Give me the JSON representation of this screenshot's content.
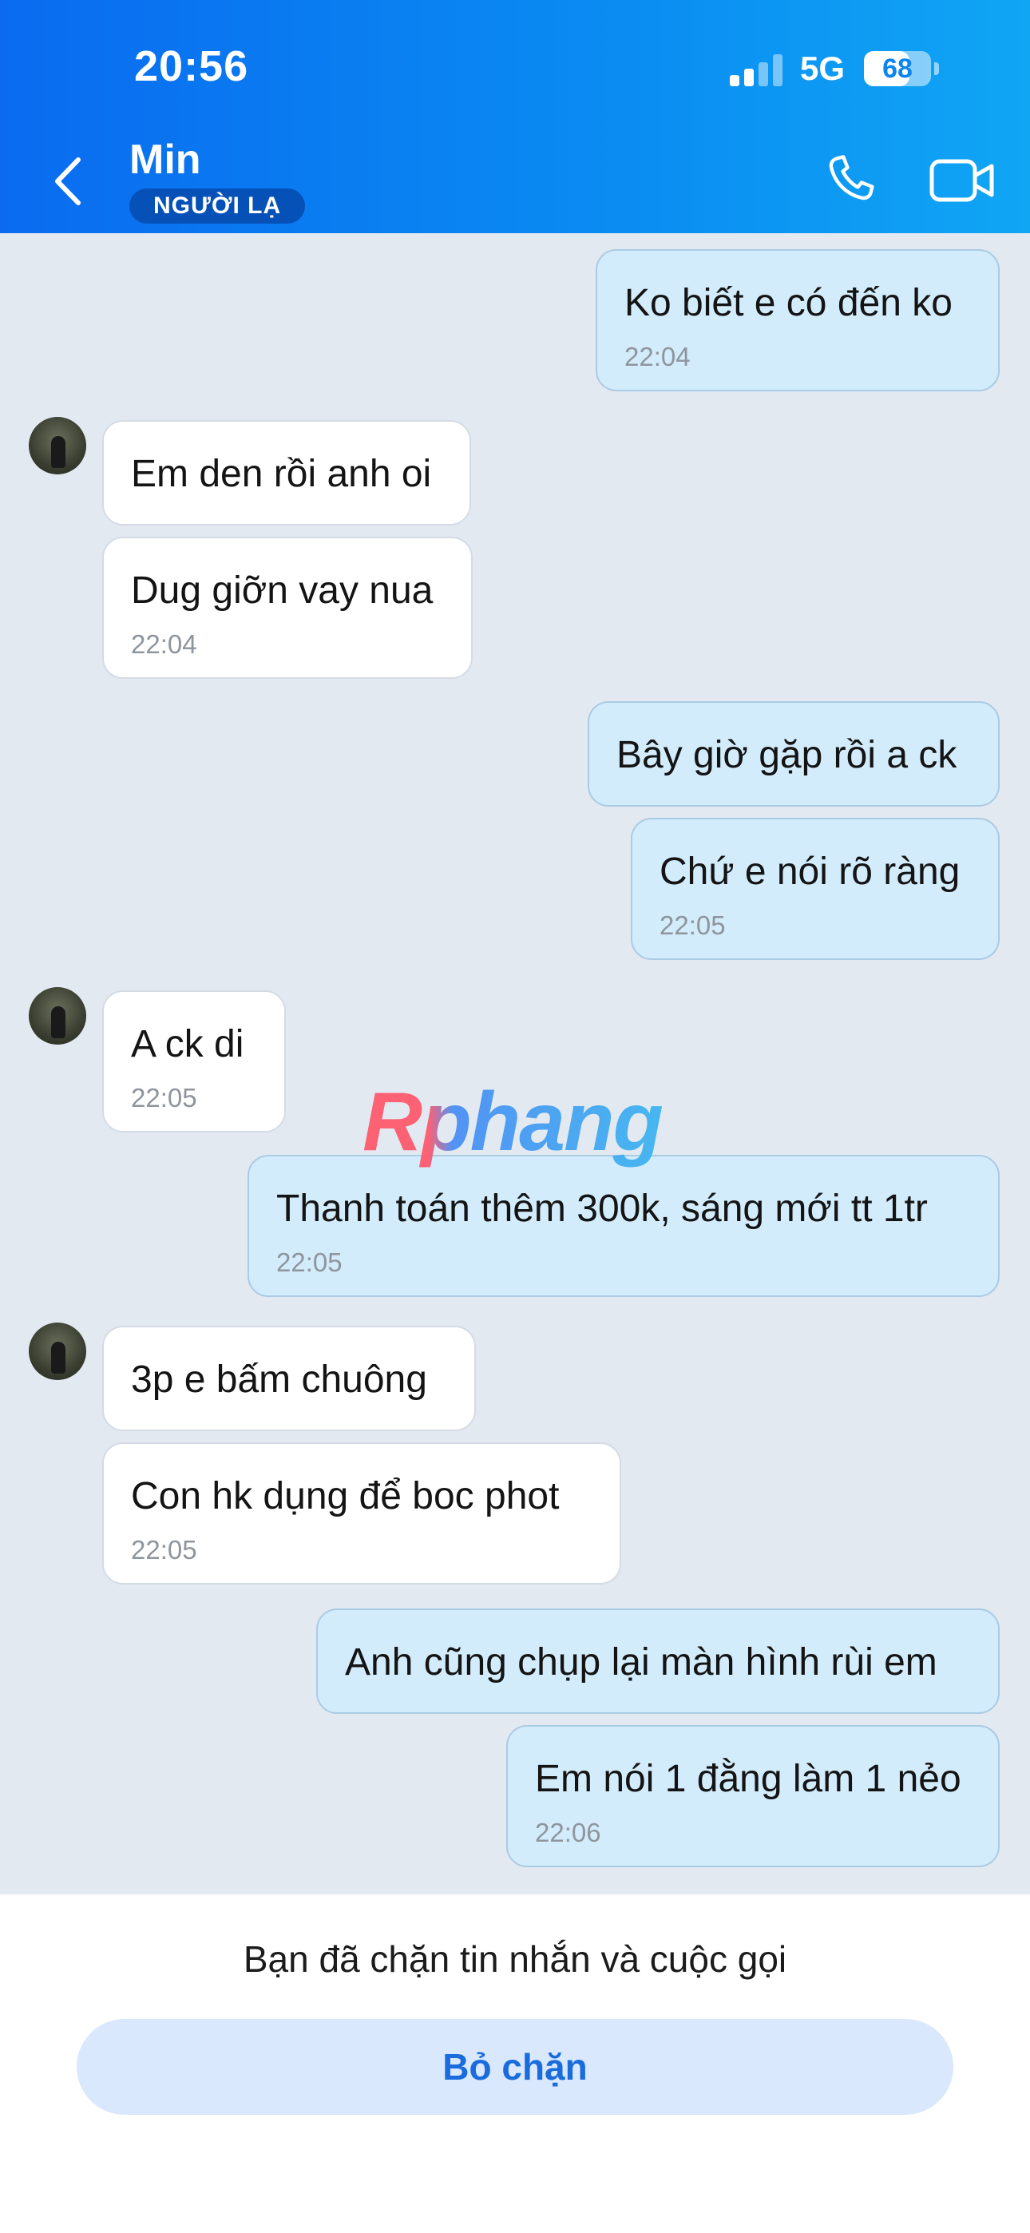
{
  "status_bar": {
    "time": "20:56",
    "network": "5G",
    "battery": "68",
    "battery_level": 0.68
  },
  "header": {
    "contact_name": "Min",
    "badge": "NGƯỜI LẠ"
  },
  "messages": [
    {
      "text": "Ko biết e có đến ko",
      "time": "22:04"
    },
    {
      "text": "Em den rồi anh oi",
      "time": ""
    },
    {
      "text": "Dug giỡn vay nua",
      "time": "22:04"
    },
    {
      "text": "Bây giờ gặp rồi a ck",
      "time": ""
    },
    {
      "text": "Chứ e nói rõ ràng",
      "time": "22:05"
    },
    {
      "text": "A ck di",
      "time": "22:05"
    },
    {
      "text": "Thanh toán thêm 300k, sáng mới tt 1tr",
      "time": "22:05"
    },
    {
      "text": "3p e bấm chuông",
      "time": ""
    },
    {
      "text": "Con hk dụng để boc phot",
      "time": "22:05"
    },
    {
      "text": "Anh cũng chụp lại màn hình rùi em",
      "time": ""
    },
    {
      "text": "Em nói 1 đằng làm 1 nẻo",
      "time": "22:06"
    }
  ],
  "watermark": "Rphang",
  "footer": {
    "blocked_notice": "Bạn đã chặn tin nhắn và cuộc gọi",
    "unblock_label": "Bỏ chặn"
  }
}
